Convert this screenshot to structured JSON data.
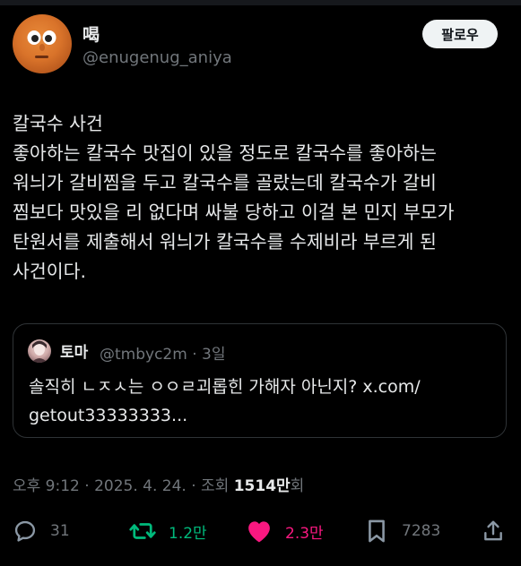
{
  "author": {
    "name": "喝",
    "handle": "@enugenug_aniya",
    "follow_label": "팔로우"
  },
  "tweet": {
    "lines": [
      "칼국수 사건",
      "좋아하는 칼국수 맛집이 있을 정도로 칼국수를 좋아하는",
      "워늬가 갈비찜을 두고 칼국수를 골랐는데 칼국수가 갈비",
      "찜보다 맛있을 리 없다며 싸불 당하고 이걸 본 민지 부모가",
      "탄원서를 제출해서 워늬가 칼국수를 수제비라 부르게 된",
      "사건이다."
    ]
  },
  "quote": {
    "name": "토마",
    "handle_time": "@tmbyc2m · 3일",
    "lines": [
      "솔직히 ㄴㅈㅅ는 ㅇㅇㄹ괴롭힌 가해자 아닌지? x.com/",
      "getout33333333..."
    ]
  },
  "meta": {
    "time_date": "오후 9:12 · 2025. 4. 24. · 조회 ",
    "views": "1514만",
    "views_suffix": "회"
  },
  "actions": {
    "replies": "31",
    "retweets": "1.2만",
    "likes": "2.3만",
    "bookmarks": "7283"
  },
  "colors": {
    "retweet": "#00ba7c",
    "like": "#f91880",
    "muted": "#71767b"
  }
}
